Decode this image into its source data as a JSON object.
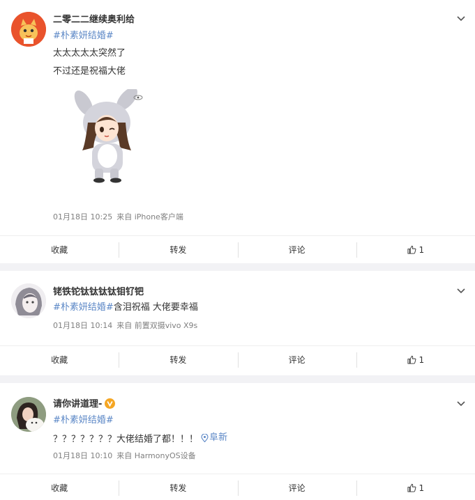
{
  "colors": {
    "topic": "#5b87c6",
    "meta": "#808080",
    "verified": "#f5a623"
  },
  "posts": [
    {
      "username": "二零二二继续奥利给",
      "topic": "#朴素妍结婚#",
      "lines": [
        "太太太太太突然了",
        "不过还是祝福大佬"
      ],
      "image": "bunny-costume-girl-sticker",
      "date": "01月18日 10:25",
      "source": "来自 iPhone客户端",
      "actions": {
        "collect": "收藏",
        "repost": "转发",
        "comment": "评论",
        "likes": "1"
      }
    },
    {
      "username": "铑铁铊钛钛钛钛钼钌钯",
      "topic": "#朴素妍结婚#",
      "text": "含泪祝福 大佬要幸福",
      "date": "01月18日 10:14",
      "source": "来自 前置双摄vivo X9s",
      "actions": {
        "collect": "收藏",
        "repost": "转发",
        "comment": "评论",
        "likes": "1"
      }
    },
    {
      "username": "请你讲道理-",
      "verified": true,
      "topic": "#朴素妍结婚#",
      "text": "？？？？？？？大佬结婚了都！！！",
      "location": "阜新",
      "date": "01月18日 10:10",
      "source": "来自 HarmonyOS设备",
      "actions": {
        "collect": "收藏",
        "repost": "转发",
        "comment": "评论",
        "likes": "1"
      }
    }
  ]
}
